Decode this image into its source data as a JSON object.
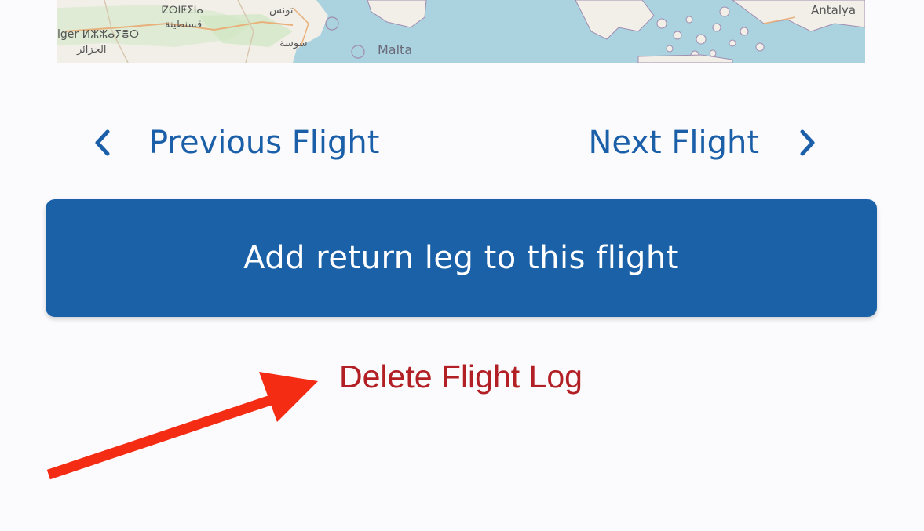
{
  "map": {
    "labels": {
      "malta": "Malta",
      "antalya": "Antalya",
      "tunis": "تونس",
      "sousse": "سوسة",
      "constantine_tf": "ⵇⵙⵏⵟⵉⵏⴰ",
      "constantine_ar": "قسنطينة",
      "alger": "lger ⵍⵣⵣⴰⵢⴻⵔ",
      "algeria_ar": "الجزائر"
    },
    "colors": {
      "sea": "#aad3df",
      "land": "#f2efe9",
      "park": "#cfe7c1"
    }
  },
  "nav": {
    "previous_label": "Previous Flight",
    "next_label": "Next Flight",
    "previous_icon": "chevron-left-icon",
    "next_icon": "chevron-right-icon",
    "color": "#1a5fa8"
  },
  "actions": {
    "add_return_leg_label": "Add return leg to this flight",
    "delete_label": "Delete Flight Log",
    "primary_color": "#1a61a8",
    "danger_color": "#b22026"
  },
  "annotation": {
    "arrow_icon": "red-arrow",
    "color": "#f42c14"
  }
}
